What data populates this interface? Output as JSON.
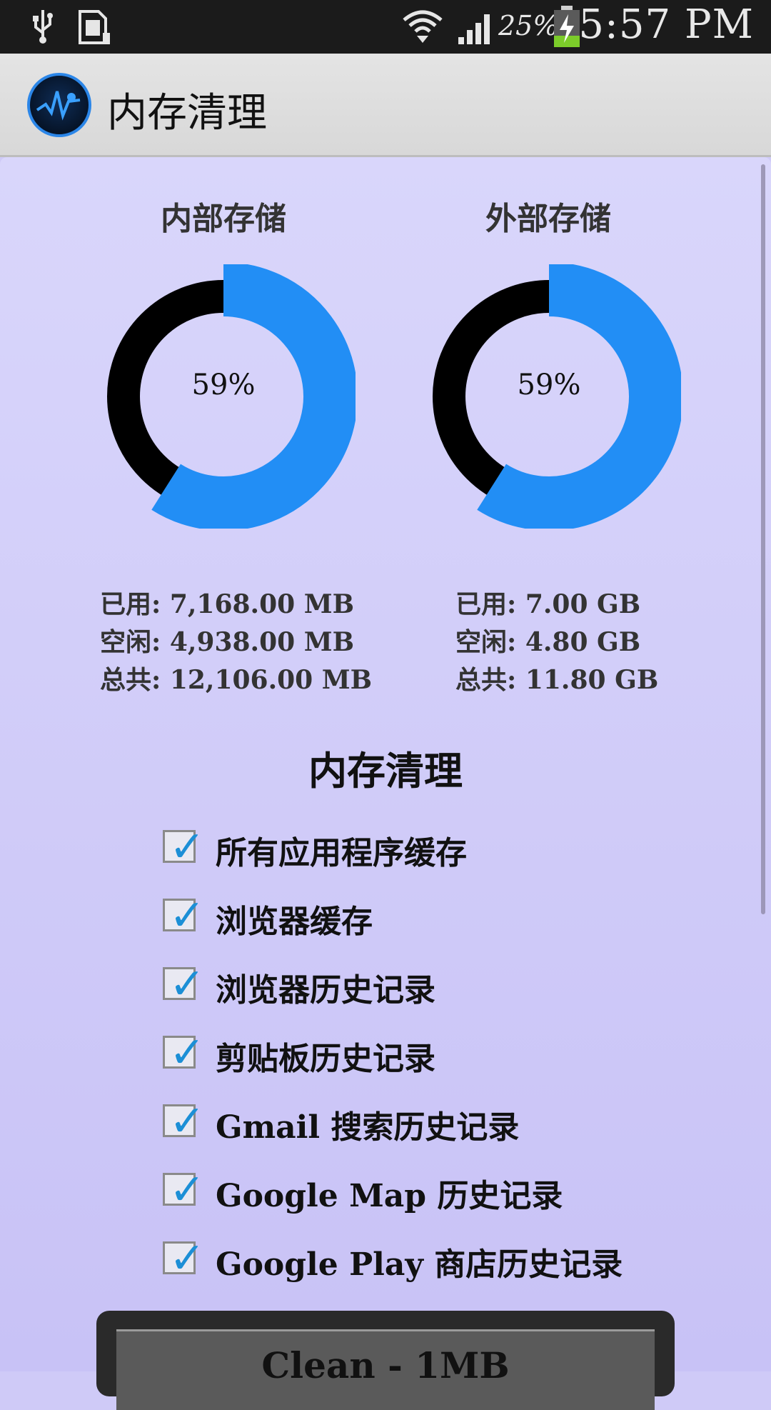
{
  "status_bar": {
    "battery_percent": "25%",
    "time": "5:57 PM",
    "icons": [
      "usb-icon",
      "sd-card-icon",
      "wifi-icon",
      "signal-icon",
      "battery-charging-icon"
    ]
  },
  "app": {
    "title": "内存清理",
    "icon": "app-logo-icon"
  },
  "storage": {
    "internal": {
      "title": "内部存储",
      "percent_label": "59%",
      "percent_used": 59,
      "used": "已用: 7,168.00 MB",
      "free": "空闲: 4,938.00 MB",
      "total": "总共: 12,106.00 MB"
    },
    "external": {
      "title": "外部存储",
      "percent_label": "59%",
      "percent_used": 59,
      "used": "已用: 7.00 GB",
      "free": "空闲: 4.80 GB",
      "total": "总共: 11.80 GB"
    }
  },
  "colors": {
    "used_ring": "#228ef5",
    "free_ring": "#000000",
    "check": "#1c8fd6"
  },
  "clean_section": {
    "title": "内存清理",
    "items": [
      {
        "label": "所有应用程序缓存",
        "checked": true
      },
      {
        "label": "浏览器缓存",
        "checked": true
      },
      {
        "label": "浏览器历史记录",
        "checked": true
      },
      {
        "label": "剪贴板历史记录",
        "checked": true
      },
      {
        "label": "Gmail 搜索历史记录",
        "checked": true
      },
      {
        "label": "Google Map 历史记录",
        "checked": true
      },
      {
        "label": "Google Play 商店历史记录",
        "checked": true
      }
    ],
    "button_label": "Clean - 1MB"
  }
}
